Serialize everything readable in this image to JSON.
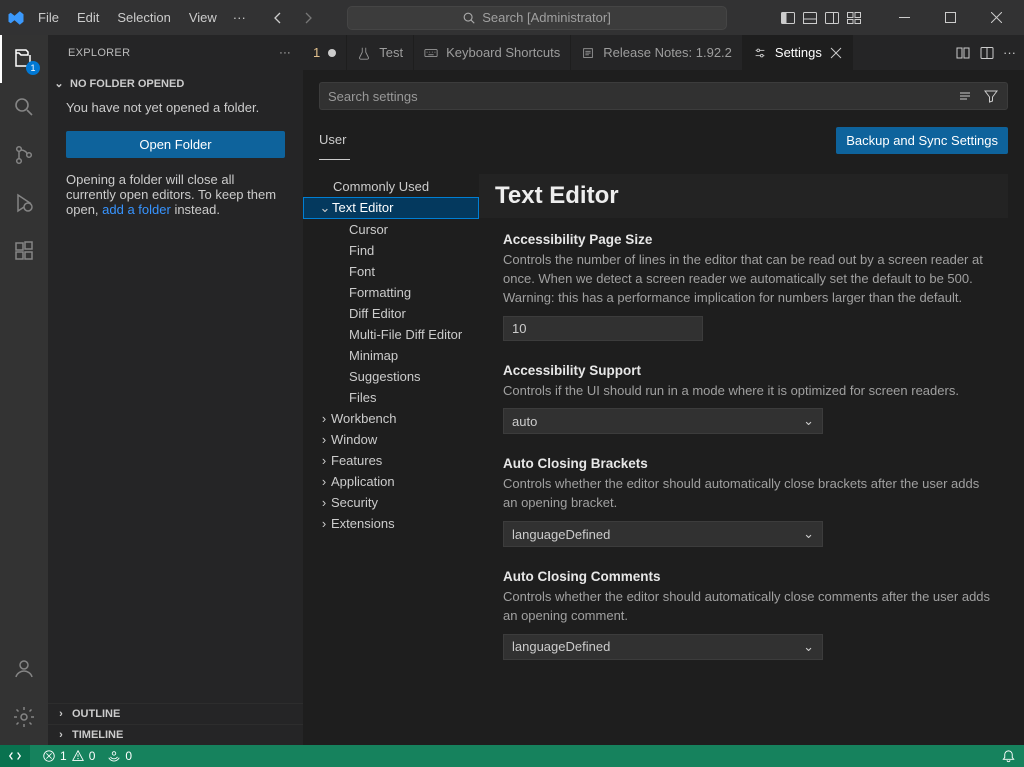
{
  "menu": {
    "file": "File",
    "edit": "Edit",
    "selection": "Selection",
    "view": "View"
  },
  "search_placeholder": "Search [Administrator]",
  "activity_badge": "1",
  "explorer": {
    "title": "EXPLORER",
    "no_folder": "NO FOLDER OPENED",
    "not_opened": "You have not yet opened a folder.",
    "open_folder": "Open Folder",
    "opening_pre": "Opening a folder will close all currently open editors. To keep them open, ",
    "add_folder": "add a folder",
    "opening_post": " instead.",
    "outline": "OUTLINE",
    "timeline": "TIMELINE"
  },
  "tabs": {
    "t1": "1",
    "t2": "Test",
    "t3": "Keyboard Shortcuts",
    "t4": "Release Notes: 1.92.2",
    "t5": "Settings"
  },
  "settings_search_placeholder": "Search settings",
  "scope_user": "User",
  "sync_btn": "Backup and Sync Settings",
  "tree": {
    "commonly": "Commonly Used",
    "texteditor": "Text Editor",
    "cursor": "Cursor",
    "find": "Find",
    "font": "Font",
    "formatting": "Formatting",
    "diff": "Diff Editor",
    "multifile": "Multi-File Diff Editor",
    "minimap": "Minimap",
    "suggestions": "Suggestions",
    "files": "Files",
    "workbench": "Workbench",
    "window": "Window",
    "features": "Features",
    "application": "Application",
    "security": "Security",
    "extensions": "Extensions"
  },
  "content": {
    "heading": "Text Editor",
    "s1_title": "Accessibility Page Size",
    "s1_desc": "Controls the number of lines in the editor that can be read out by a screen reader at once. When we detect a screen reader we automatically set the default to be 500. Warning: this has a performance implication for numbers larger than the default.",
    "s1_value": "10",
    "s2_title": "Accessibility Support",
    "s2_desc": "Controls if the UI should run in a mode where it is optimized for screen readers.",
    "s2_value": "auto",
    "s3_title": "Auto Closing Brackets",
    "s3_desc": "Controls whether the editor should automatically close brackets after the user adds an opening bracket.",
    "s3_value": "languageDefined",
    "s4_title": "Auto Closing Comments",
    "s4_desc": "Controls whether the editor should automatically close comments after the user adds an opening comment.",
    "s4_value": "languageDefined"
  },
  "status": {
    "errors": "1",
    "warnings": "0",
    "ports": "0"
  }
}
